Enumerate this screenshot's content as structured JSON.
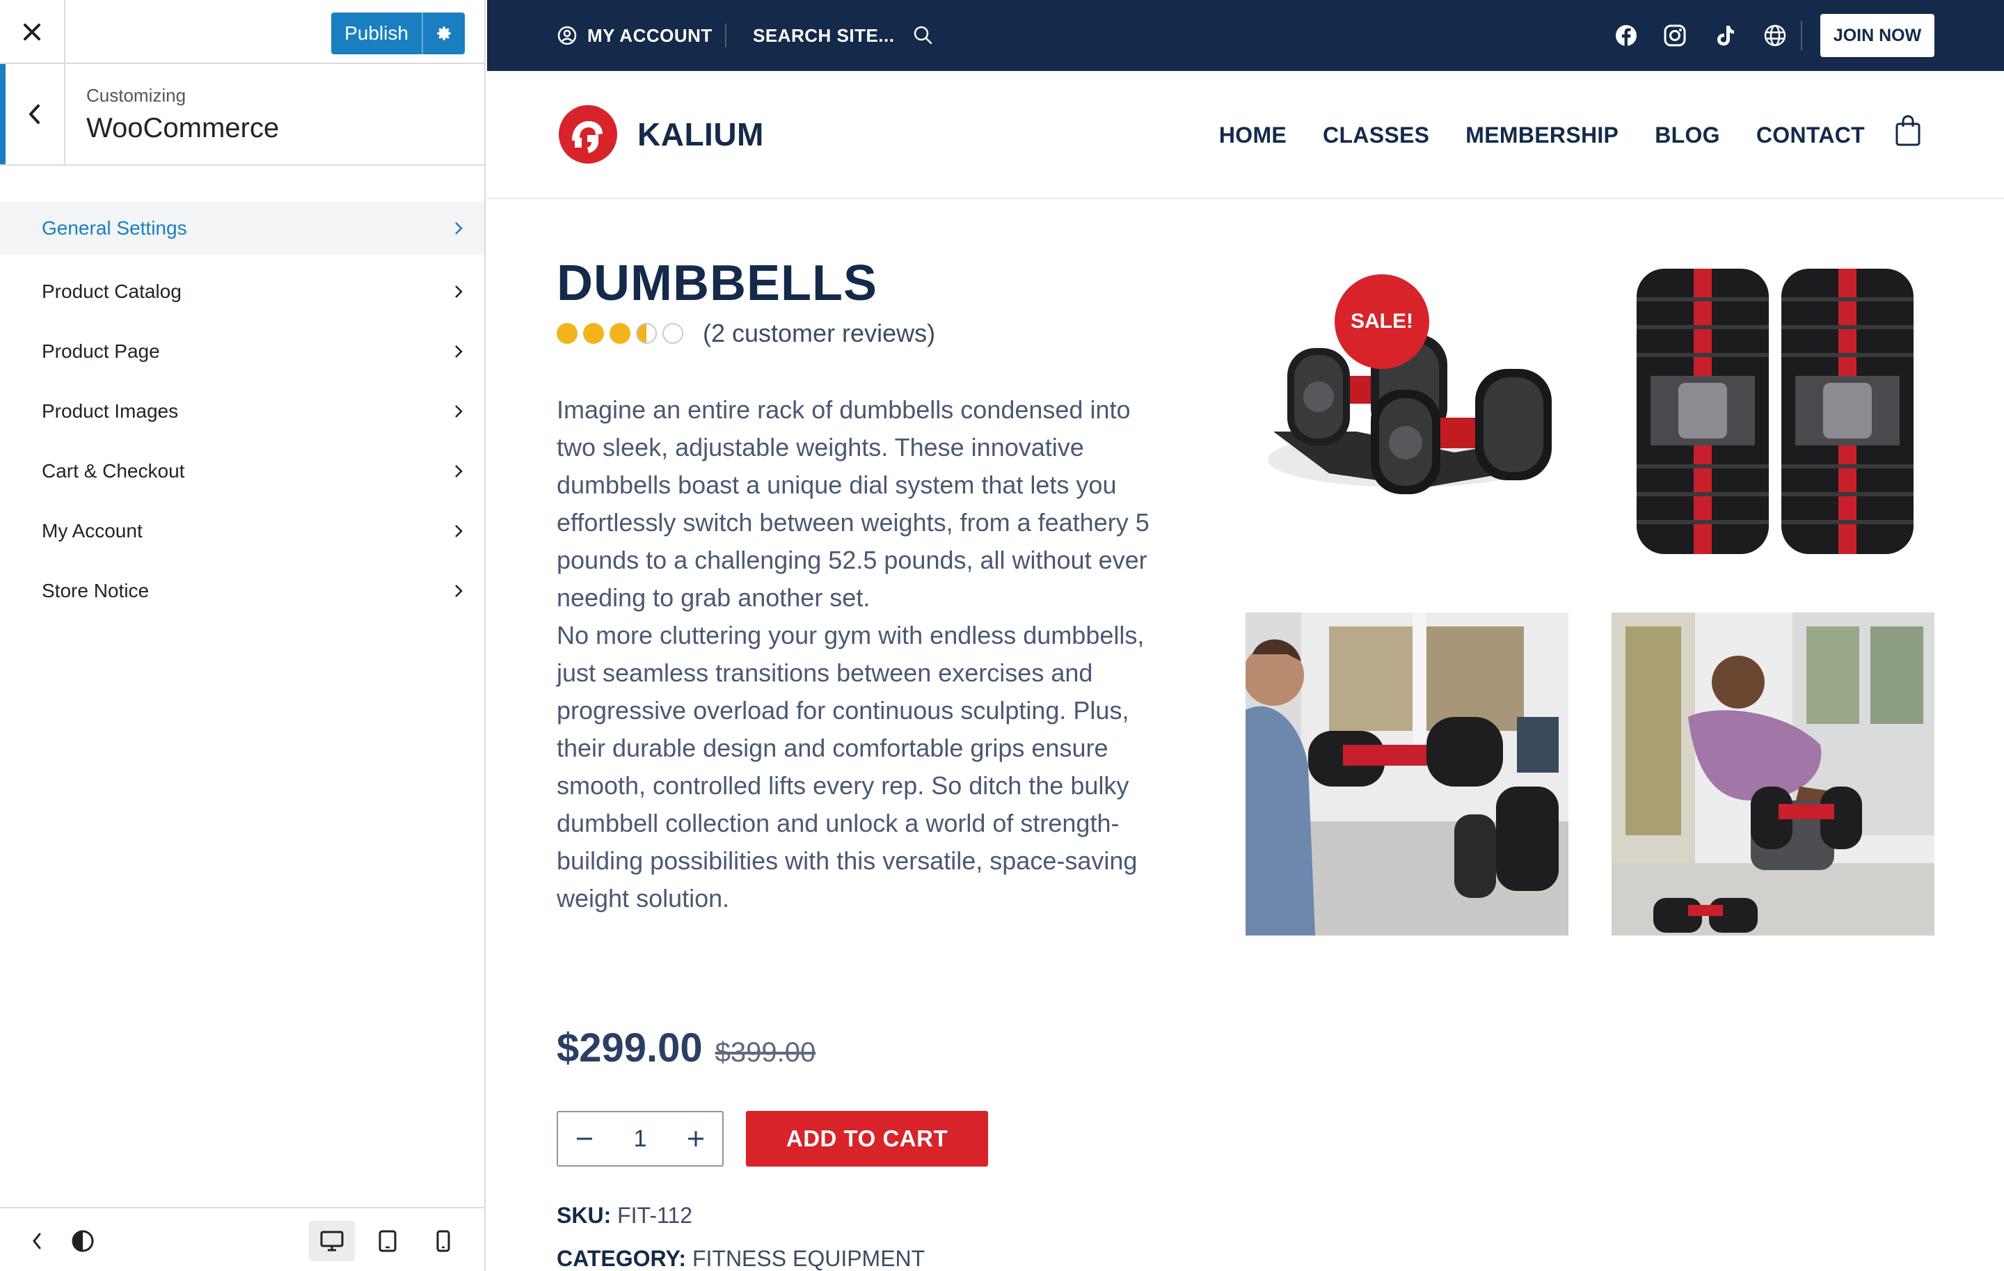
{
  "customizer": {
    "publish_label": "Publish",
    "customizing_label": "Customizing",
    "section_title": "WooCommerce",
    "items": [
      {
        "label": "General Settings"
      },
      {
        "label": "Product Catalog"
      },
      {
        "label": "Product Page"
      },
      {
        "label": "Product Images"
      },
      {
        "label": "Cart & Checkout"
      },
      {
        "label": "My Account"
      },
      {
        "label": "Store Notice"
      }
    ],
    "accent_color": "#1a7fc0"
  },
  "topbar": {
    "account_label": "MY ACCOUNT",
    "search_label": "SEARCH SITE...",
    "join_label": "JOIN NOW",
    "bg_color": "#142a4a"
  },
  "header": {
    "logo_text": "KALIUM",
    "nav": [
      "HOME",
      "CLASSES",
      "MEMBERSHIP",
      "BLOG",
      "CONTACT"
    ]
  },
  "product": {
    "title": "DUMBBELLS",
    "rating": 3.5,
    "reviews_label": "(2 customer reviews)",
    "description_1": "Imagine an entire rack of dumbbells condensed into two sleek, adjustable weights. These innovative dumbbells boast a unique dial system that lets you effortlessly switch between weights, from a feathery 5 pounds to a challenging 52.5 pounds, all without ever needing to grab another set.",
    "description_2": "No more cluttering your gym with endless dumbbells, just seamless transitions between exercises and progressive overload for continuous sculpting. Plus, their durable design and comfortable grips ensure smooth, controlled lifts every rep. So ditch the bulky dumbbell collection and unlock a world of strength-building possibilities with this versatile, space-saving weight solution.",
    "price": "$299.00",
    "old_price": "$399.00",
    "quantity": "1",
    "add_to_cart_label": "ADD TO CART",
    "sku_label": "SKU:",
    "sku_value": "FIT-112",
    "category_label": "CATEGORY:",
    "category_value": "FITNESS EQUIPMENT",
    "sale_badge": "SALE!",
    "accent_color": "#d8232a"
  }
}
